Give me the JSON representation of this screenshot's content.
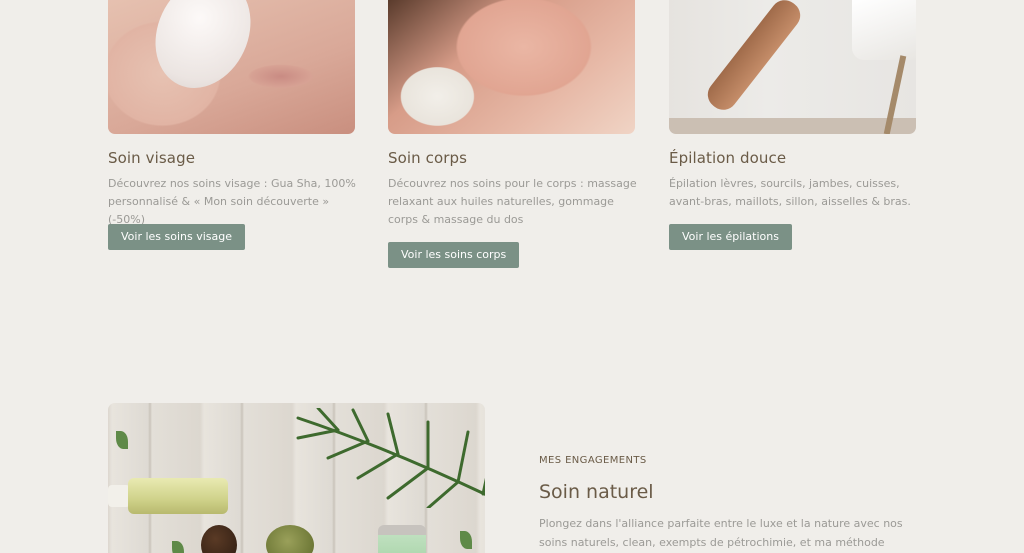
{
  "services": [
    {
      "title": "Soin visage",
      "description": "Découvrez nos soins visage : Gua Sha, 100% personnalisé & « Mon soin découverte » (-50%)",
      "button": "Voir les soins visage"
    },
    {
      "title": "Soin corps",
      "description": "Découvrez nos soins pour le corps : massage relaxant aux huiles naturelles, gommage corps & massage du dos",
      "button": "Voir les soins corps"
    },
    {
      "title": "Épilation douce",
      "description": "Épilation lèvres, sourcils, jambes, cuisses, avant-bras, maillots, sillon, aisselles & bras.",
      "button": "Voir les épilations"
    }
  ],
  "engagement": {
    "kicker": "MES ENGAGEMENTS",
    "title": "Soin naturel",
    "text": "Plongez dans l'alliance parfaite entre le luxe et la nature avec nos soins naturels, clean, exempts de pétrochimie, et ma méthode d'épilation"
  },
  "colors": {
    "background": "#f0eeea",
    "heading": "#6a5b47",
    "body_text": "#9b9a96",
    "button": "#7b9186"
  }
}
